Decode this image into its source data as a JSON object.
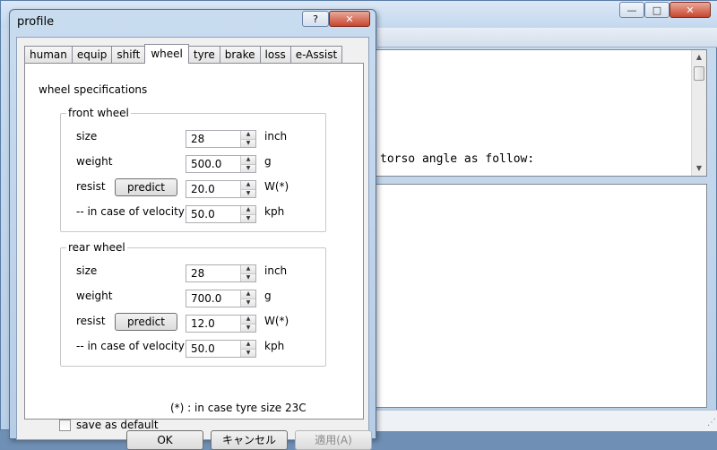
{
  "dialog": {
    "title": "profile",
    "help_button": "?",
    "close_button": "✕",
    "tabs": [
      {
        "label": "human"
      },
      {
        "label": "equip"
      },
      {
        "label": "shift"
      },
      {
        "label": "wheel",
        "active": true
      },
      {
        "label": "tyre"
      },
      {
        "label": "brake"
      },
      {
        "label": "loss"
      },
      {
        "label": "e-Assist"
      }
    ],
    "panel_title": "wheel specifications",
    "front": {
      "title": "front wheel",
      "size_label": "size",
      "size_value": "28",
      "size_unit": "inch",
      "weight_label": "weight",
      "weight_value": "500.0",
      "weight_unit": "g",
      "resist_label": "resist",
      "predict_label": "predict",
      "resist_value": "20.0",
      "resist_unit": "W(*)",
      "velocity_label": "-- in case of velocity",
      "velocity_value": "50.0",
      "velocity_unit": "kph"
    },
    "rear": {
      "title": "rear wheel",
      "size_label": "size",
      "size_value": "28",
      "size_unit": "inch",
      "weight_label": "weight",
      "weight_value": "700.0",
      "weight_unit": "g",
      "resist_label": "resist",
      "predict_label": "predict",
      "resist_value": "12.0",
      "resist_unit": "W(*)",
      "velocity_label": "-- in case of velocity",
      "velocity_value": "50.0",
      "velocity_unit": "kph"
    },
    "note": "(*) : in case tyre size 23C",
    "save_default_label": "save as default",
    "save_default_checked": false,
    "ok_label": "OK",
    "cancel_label": "キャンセル",
    "apply_label": "適用(A)"
  },
  "main_window": {
    "minimize": "—",
    "maximize": "□",
    "close": "✕",
    "text_line": "torso angle as follow:"
  }
}
